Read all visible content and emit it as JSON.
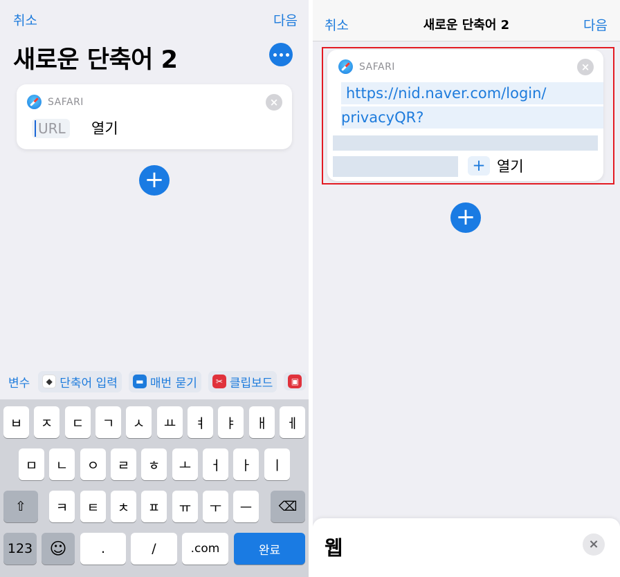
{
  "left": {
    "nav": {
      "cancel": "취소",
      "next": "다음"
    },
    "title": "새로운 단축어 2",
    "card": {
      "app_name": "SAFARI",
      "url_placeholder": "URL",
      "action_text": "열기",
      "close_icon": "×"
    },
    "add_icon": "+",
    "suggestions": {
      "variables_label": "변수",
      "chips": [
        {
          "label": "단축어 입력",
          "icon": "layers-icon"
        },
        {
          "label": "매번 묻기",
          "icon": "chat-icon"
        },
        {
          "label": "클립보드",
          "icon": "scissors-icon"
        }
      ]
    },
    "keyboard": {
      "row1": [
        "ㅂ",
        "ㅈ",
        "ㄷ",
        "ㄱ",
        "ㅅ",
        "ㅛ",
        "ㅕ",
        "ㅑ",
        "ㅐ",
        "ㅔ"
      ],
      "row2": [
        "ㅁ",
        "ㄴ",
        "ㅇ",
        "ㄹ",
        "ㅎ",
        "ㅗ",
        "ㅓ",
        "ㅏ",
        "ㅣ"
      ],
      "row3": [
        "ㅋ",
        "ㅌ",
        "ㅊ",
        "ㅍ",
        "ㅠ",
        "ㅜ",
        "ㅡ"
      ],
      "shift": "⇧",
      "delete": "⌫",
      "numbers": "123",
      "emoji": "☺",
      "dot": ".",
      "slash": "/",
      "dotcom": ".com",
      "done": "완료"
    }
  },
  "right": {
    "nav": {
      "cancel": "취소",
      "title": "새로운 단축어 2",
      "next": "다음"
    },
    "card": {
      "app_name": "SAFARI",
      "url_line1": "https://nid.naver.com/login/",
      "url_line2": "privacyQR?",
      "plus_token": "+",
      "action_text": "열기",
      "close_icon": "×"
    },
    "add_icon": "+",
    "sheet": {
      "title": "웹",
      "close_icon": "×"
    }
  },
  "colors": {
    "accent": "#1a7be3",
    "highlight": "#e31b23"
  }
}
